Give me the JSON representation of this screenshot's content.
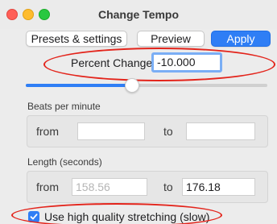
{
  "window": {
    "title": "Change Tempo"
  },
  "toolbar": {
    "presets_label": "Presets & settings",
    "preview_label": "Preview",
    "apply_label": "Apply"
  },
  "percent_change": {
    "label": "Percent Change:",
    "value": "-10.000",
    "slider_fraction": 0.44
  },
  "bpm": {
    "section_label": "Beats per minute",
    "from_label": "from",
    "from_value": "",
    "to_label": "to",
    "to_value": ""
  },
  "length": {
    "section_label": "Length (seconds)",
    "from_label": "from",
    "from_value": "158.56",
    "to_label": "to",
    "to_value": "176.18"
  },
  "options": {
    "high_quality_label": "Use high quality stretching (slow)",
    "high_quality_checked": true
  },
  "colors": {
    "accent": "#2f7ef5",
    "annotation": "#e3241b"
  }
}
